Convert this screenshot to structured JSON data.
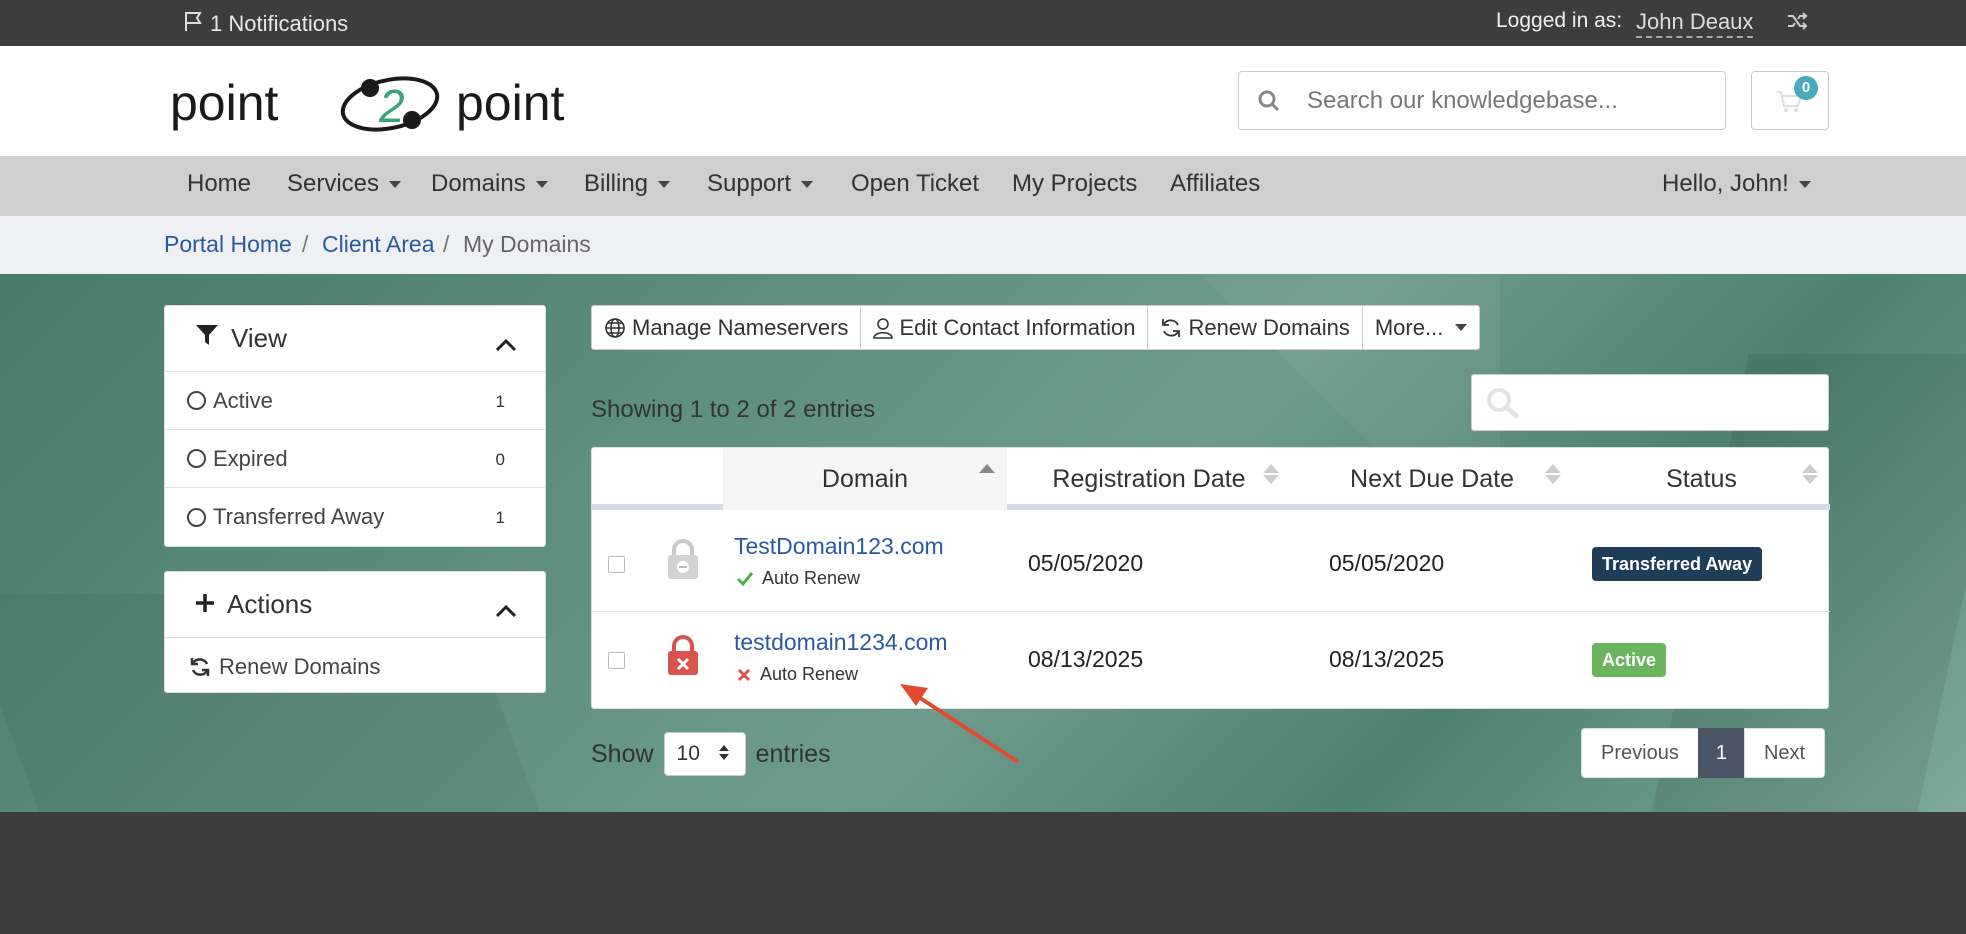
{
  "topbar": {
    "notifications": "1 Notifications",
    "logged_in_label": "Logged in as:",
    "user_name": "John Deaux"
  },
  "header": {
    "logo_text_left": "point",
    "logo_text_mid": "2",
    "logo_text_right": "point",
    "search_placeholder": "Search our knowledgebase...",
    "cart_count": "0"
  },
  "nav": {
    "items": [
      {
        "label": "Home"
      },
      {
        "label": "Services"
      },
      {
        "label": "Domains"
      },
      {
        "label": "Billing"
      },
      {
        "label": "Support"
      },
      {
        "label": "Open Ticket"
      },
      {
        "label": "My Projects"
      },
      {
        "label": "Affiliates"
      }
    ],
    "greeting": "Hello, John!"
  },
  "breadcrumb": {
    "home": "Portal Home",
    "client": "Client Area",
    "current": "My Domains",
    "sep": "/"
  },
  "sidebar": {
    "view_title": "View",
    "filters": [
      {
        "label": "Active",
        "count": "1"
      },
      {
        "label": "Expired",
        "count": "0"
      },
      {
        "label": "Transferred Away",
        "count": "1"
      }
    ],
    "actions_title": "Actions",
    "actions": [
      {
        "label": "Renew Domains"
      }
    ]
  },
  "toolbar": {
    "manage_ns": "Manage Nameservers",
    "edit_contact": "Edit Contact Information",
    "renew": "Renew Domains",
    "more": "More..."
  },
  "table": {
    "showing": "Showing 1 to 2 of 2 entries",
    "columns": [
      "Domain",
      "Registration Date",
      "Next Due Date",
      "Status"
    ],
    "rows": [
      {
        "domain": "TestDomain123.com",
        "auto_renew": "Auto Renew",
        "auto_renew_on": true,
        "reg_date": "05/05/2020",
        "next_due": "05/05/2020",
        "status": "Transferred Away",
        "status_color": "#1f3d57"
      },
      {
        "domain": "testdomain1234.com",
        "auto_renew": "Auto Renew",
        "auto_renew_on": false,
        "reg_date": "08/13/2025",
        "next_due": "08/13/2025",
        "status": "Active",
        "status_color": "#6cb55f"
      }
    ]
  },
  "length": {
    "show": "Show",
    "value": "10",
    "entries": "entries"
  },
  "pager": {
    "previous": "Previous",
    "page": "1",
    "next": "Next"
  },
  "colors": {
    "link": "#2a5a9e",
    "topbar_bg": "#3d3d3d",
    "nav_bg": "#cfcfcf",
    "arrow": "#e04a2f"
  }
}
